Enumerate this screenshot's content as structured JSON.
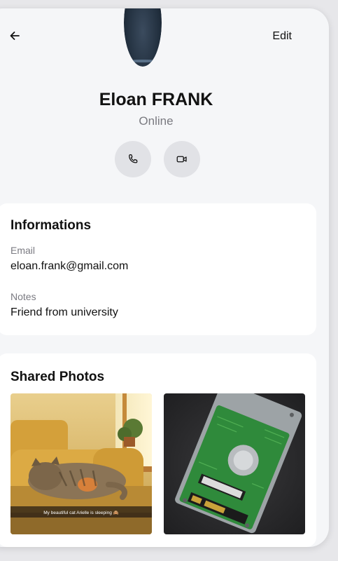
{
  "header": {
    "edit_label": "Edit"
  },
  "profile": {
    "name": "Eloan FRANK",
    "status": "Online"
  },
  "actions": {
    "call_icon": "phone-icon",
    "video_icon": "video-camera-icon"
  },
  "informations": {
    "title": "Informations",
    "email_label": "Email",
    "email_value": "eloan.frank@gmail.com",
    "notes_label": "Notes",
    "notes_value": "Friend from university"
  },
  "shared_photos": {
    "title": "Shared Photos",
    "photos": [
      {
        "caption": "My beautiful cat Arielle is sleeping 🙈"
      },
      {
        "caption": ""
      }
    ]
  },
  "colors": {
    "background": "#f5f6f8",
    "card": "#ffffff",
    "action_button": "#e1e2e6",
    "secondary_text": "#7a7a80"
  }
}
